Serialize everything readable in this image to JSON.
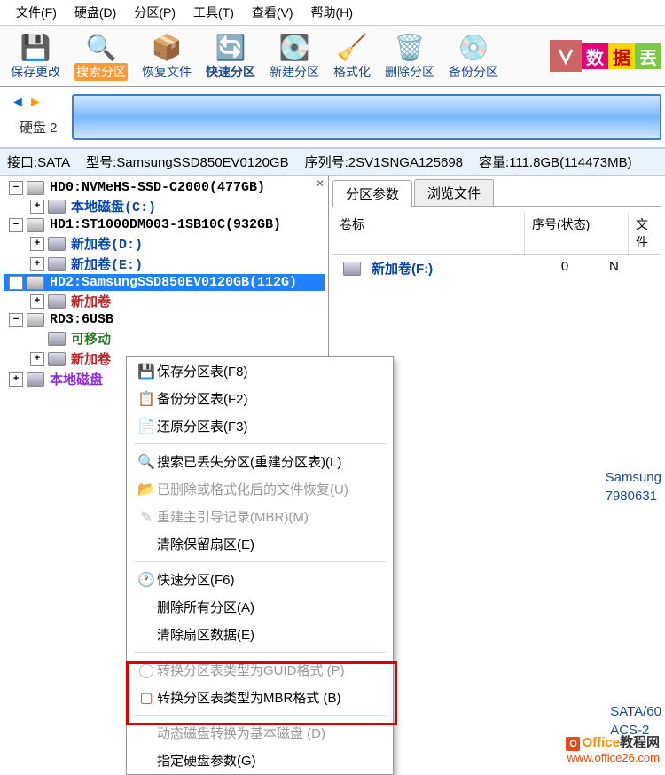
{
  "menu": {
    "file": "文件(F)",
    "disk": "硬盘(D)",
    "part": "分区(P)",
    "tool": "工具(T)",
    "view": "查看(V)",
    "help": "帮助(H)"
  },
  "toolbar": {
    "save": "保存更改",
    "search": "搜索分区",
    "recover": "恢复文件",
    "quick": "快速分区",
    "newpart": "新建分区",
    "format": "格式化",
    "delete": "删除分区",
    "backup": "备份分区"
  },
  "logo": {
    "a": "数",
    "b": "据",
    "c": "丟"
  },
  "diskhead": {
    "label": "硬盘 2"
  },
  "infobar": {
    "iface": "接口:SATA",
    "model": "型号:SamsungSSD850EV0120GB",
    "serial": "序列号:2SV1SNGA125698",
    "cap": "容量:111.8GB(114473MB)"
  },
  "tree": {
    "hd0": "HD0:NVMeHS-SSD-C2000(477GB)",
    "hd0v0": "本地磁盘(C:)",
    "hd1": "HD1:ST1000DM003-1SB10C(932GB)",
    "hd1v0": "新加卷(D:)",
    "hd1v1": "新加卷(E:)",
    "hd2": "HD2:SamsungSSD850EV0120GB(112G)",
    "hd2v0": "新加卷",
    "rd3": "RD3:6USB",
    "rd3v0": "可移动",
    "rd3v1": "新加卷",
    "local": "本地磁盘"
  },
  "tabs": {
    "params": "分区参数",
    "browse": "浏览文件"
  },
  "grid": {
    "h1": "卷标",
    "h2": "序号(状态)",
    "h3": "文件",
    "r1_label": "新加卷(F:)",
    "r1_idx": "0",
    "r1_fs": "N"
  },
  "ctx": {
    "save": "保存分区表(F8)",
    "backup": "备份分区表(F2)",
    "restore": "还原分区表(F3)",
    "search": "搜索已丢失分区(重建分区表)(L)",
    "undel": "已删除或格式化后的文件恢复(U)",
    "mbr": "重建主引导记录(MBR)(M)",
    "clrres": "清除保留扇区(E)",
    "quick": "快速分区(F6)",
    "delall": "删除所有分区(A)",
    "clrsec": "清除扇区数据(E)",
    "toguid": "转换分区表类型为GUID格式 (P)",
    "tombr": "转换分区表类型为MBR格式 (B)",
    "dyn": "动态磁盘转换为基本磁盘 (D)",
    "params": "指定硬盘参数(G)"
  },
  "sideinfo": {
    "l1": "Samsung",
    "l2": "7980631"
  },
  "sideinfo2": {
    "l1": "SATA/60",
    "l2": "ACS-2"
  },
  "watermark": {
    "l1a": "Office",
    "l1b": "教程网",
    "l2": "www.office26.com"
  }
}
